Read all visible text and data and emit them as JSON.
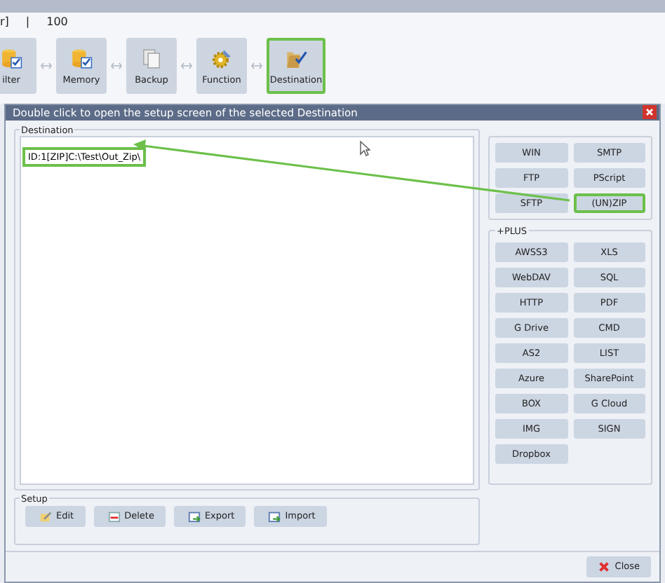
{
  "header": {
    "text": "r]",
    "separator": "|",
    "value": "100"
  },
  "toolbar": [
    {
      "label": "ilter",
      "kind": "filter",
      "selected": false
    },
    {
      "label": "Memory",
      "kind": "memory",
      "selected": false
    },
    {
      "label": "Backup",
      "kind": "backup",
      "selected": false
    },
    {
      "label": "Function",
      "kind": "function",
      "selected": false
    },
    {
      "label": "Destination",
      "kind": "destination",
      "selected": true
    }
  ],
  "dialog": {
    "title": "Double click to open the setup screen of the selected Destination",
    "destination": {
      "legend": "Destination",
      "items": [
        {
          "text": "ID:1[ZIP]C:\\Test\\Out_Zip\\",
          "highlighted": true
        }
      ]
    },
    "basic_buttons": [
      {
        "label": "WIN",
        "highlighted": false
      },
      {
        "label": "SMTP",
        "highlighted": false
      },
      {
        "label": "FTP",
        "highlighted": false
      },
      {
        "label": "PScript",
        "highlighted": false
      },
      {
        "label": "SFTP",
        "highlighted": false
      },
      {
        "label": "(UN)ZIP",
        "highlighted": true
      }
    ],
    "plus": {
      "legend": "+PLUS",
      "buttons": [
        {
          "label": "AWSS3"
        },
        {
          "label": "XLS"
        },
        {
          "label": "WebDAV"
        },
        {
          "label": "SQL"
        },
        {
          "label": "HTTP"
        },
        {
          "label": "PDF"
        },
        {
          "label": "G Drive"
        },
        {
          "label": "CMD"
        },
        {
          "label": "AS2"
        },
        {
          "label": "LIST"
        },
        {
          "label": "Azure"
        },
        {
          "label": "SharePoint"
        },
        {
          "label": "BOX"
        },
        {
          "label": "G Cloud"
        },
        {
          "label": "IMG"
        },
        {
          "label": "SIGN"
        },
        {
          "label": "Dropbox"
        }
      ]
    },
    "setup": {
      "legend": "Setup",
      "buttons": [
        {
          "label": "Edit",
          "kind": "edit"
        },
        {
          "label": "Delete",
          "kind": "delete"
        },
        {
          "label": "Export",
          "kind": "export"
        },
        {
          "label": "Import",
          "kind": "import"
        }
      ]
    },
    "close": {
      "label": "Close"
    }
  }
}
